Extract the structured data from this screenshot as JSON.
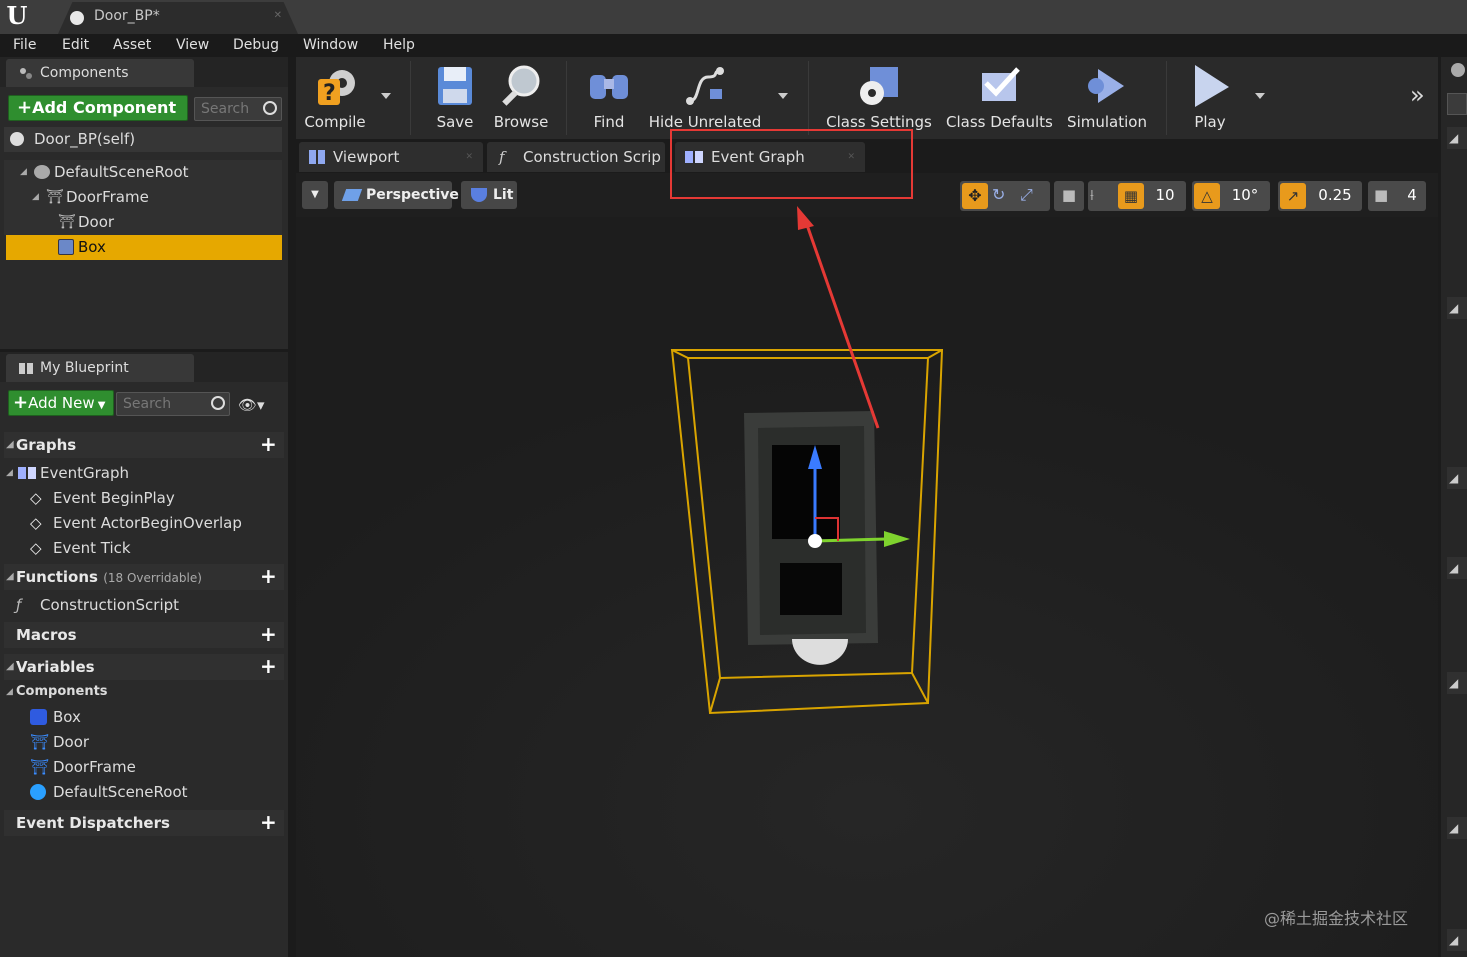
{
  "app": {
    "logo": "U",
    "doc_tab": "Door_BP*"
  },
  "menu": [
    "File",
    "Edit",
    "Asset",
    "View",
    "Debug",
    "Window",
    "Help"
  ],
  "components_panel": {
    "tab": "Components",
    "add_component": "Add Component",
    "search_placeholder": "Search",
    "self_label": "Door_BP(self)",
    "tree": [
      "DefaultSceneRoot",
      "DoorFrame",
      "Door",
      "Box"
    ],
    "selected": "Box"
  },
  "my_blueprint": {
    "tab": "My Blueprint",
    "add_new": "Add New",
    "search_placeholder": "Search",
    "graphs_header": "Graphs",
    "event_graph": "EventGraph",
    "events": [
      "Event BeginPlay",
      "Event ActorBeginOverlap",
      "Event Tick"
    ],
    "functions_header": "Functions",
    "functions_note": "(18 Overridable)",
    "construction_script": "ConstructionScript",
    "macros_header": "Macros",
    "variables_header": "Variables",
    "components_header": "Components",
    "component_vars": [
      "Box",
      "Door",
      "DoorFrame",
      "DefaultSceneRoot"
    ],
    "dispatchers_header": "Event Dispatchers"
  },
  "toolbar": {
    "compile": "Compile",
    "save": "Save",
    "browse": "Browse",
    "find": "Find",
    "hide_unrelated": "Hide Unrelated",
    "class_settings": "Class Settings",
    "class_defaults": "Class Defaults",
    "simulation": "Simulation",
    "play": "Play"
  },
  "editor_tabs": {
    "viewport": "Viewport",
    "construction": "Construction Scrip",
    "event_graph": "Event Graph"
  },
  "viewport": {
    "perspective": "Perspective",
    "lit": "Lit",
    "grid_snap": "10",
    "rotation_snap": "10°",
    "scale_snap": "0.25",
    "camera_speed": "4"
  },
  "annotation": {
    "highlight_color": "#e53935"
  },
  "watermark": "@稀土掘金技术社区",
  "colors": {
    "selected": "#e6a800",
    "add_green": "#2f8e2f",
    "gizmo_x": "#7fd32e",
    "gizmo_z": "#3a7bff",
    "bounds": "#d9a400"
  }
}
